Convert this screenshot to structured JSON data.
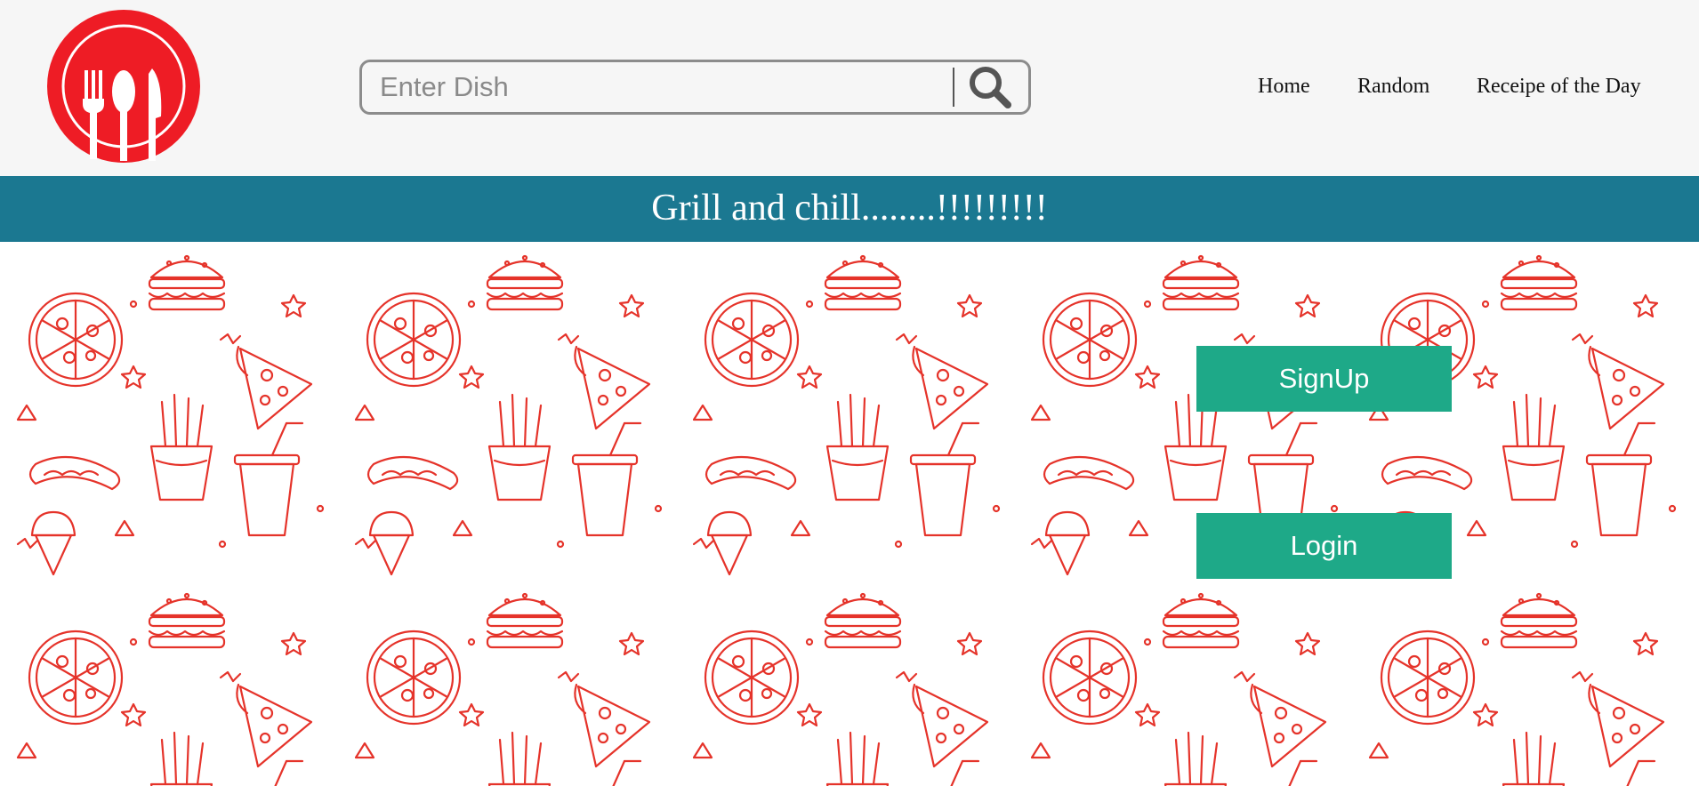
{
  "colors": {
    "logo_red": "#ee1c25",
    "banner_teal": "#1b7891",
    "button_green": "#1ea988",
    "pattern_red": "#e5332a",
    "header_bg": "#f6f6f6"
  },
  "logo": {
    "icon": "plate-fork-spoon-knife-icon"
  },
  "search": {
    "placeholder": "Enter Dish",
    "value": "",
    "icon": "search-icon"
  },
  "nav": {
    "items": [
      {
        "label": "Home"
      },
      {
        "label": "Random"
      },
      {
        "label": "Receipe of the Day"
      }
    ]
  },
  "banner": {
    "text": "Grill and chill........!!!!!!!!!"
  },
  "hero": {
    "background_pattern": "food-doodle-pattern",
    "signup_label": "SignUp",
    "login_label": "Login"
  }
}
